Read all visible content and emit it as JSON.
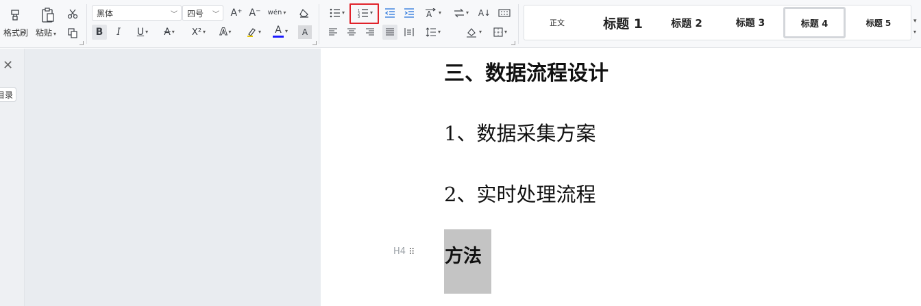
{
  "ribbon": {
    "format_painter_label": "格式刷",
    "paste_label": "粘贴",
    "font_family": "黑体",
    "font_size": "四号",
    "bold_glyph": "B",
    "italic_glyph": "I",
    "underline_glyph": "U",
    "strike_glyph": "A",
    "superscript_glyph": "X²",
    "text_effect_glyph": "A",
    "font_color_glyph": "A",
    "char_shading_glyph": "A",
    "grow_font_glyph": "A⁺",
    "shrink_font_glyph": "A⁻",
    "phonetic_glyph": "wén",
    "sort_glyph": "A↓",
    "font_color_accent": "#1a1aff"
  },
  "styles": {
    "normal": "正文",
    "heading1": "标题 1",
    "heading2": "标题 2",
    "heading3": "标题 3",
    "heading4": "标题 4",
    "heading5": "标题 5"
  },
  "left_panel": {
    "toc_button": "目录"
  },
  "document": {
    "section_heading": "三、数据流程设计",
    "item1": "1、数据采集方案",
    "item2": "2、实时处理流程",
    "selected_heading": "方法",
    "heading_level_marker": "H4"
  },
  "colors": {
    "highlight_box": "#e0222a",
    "selection": "#c4c4c4"
  }
}
